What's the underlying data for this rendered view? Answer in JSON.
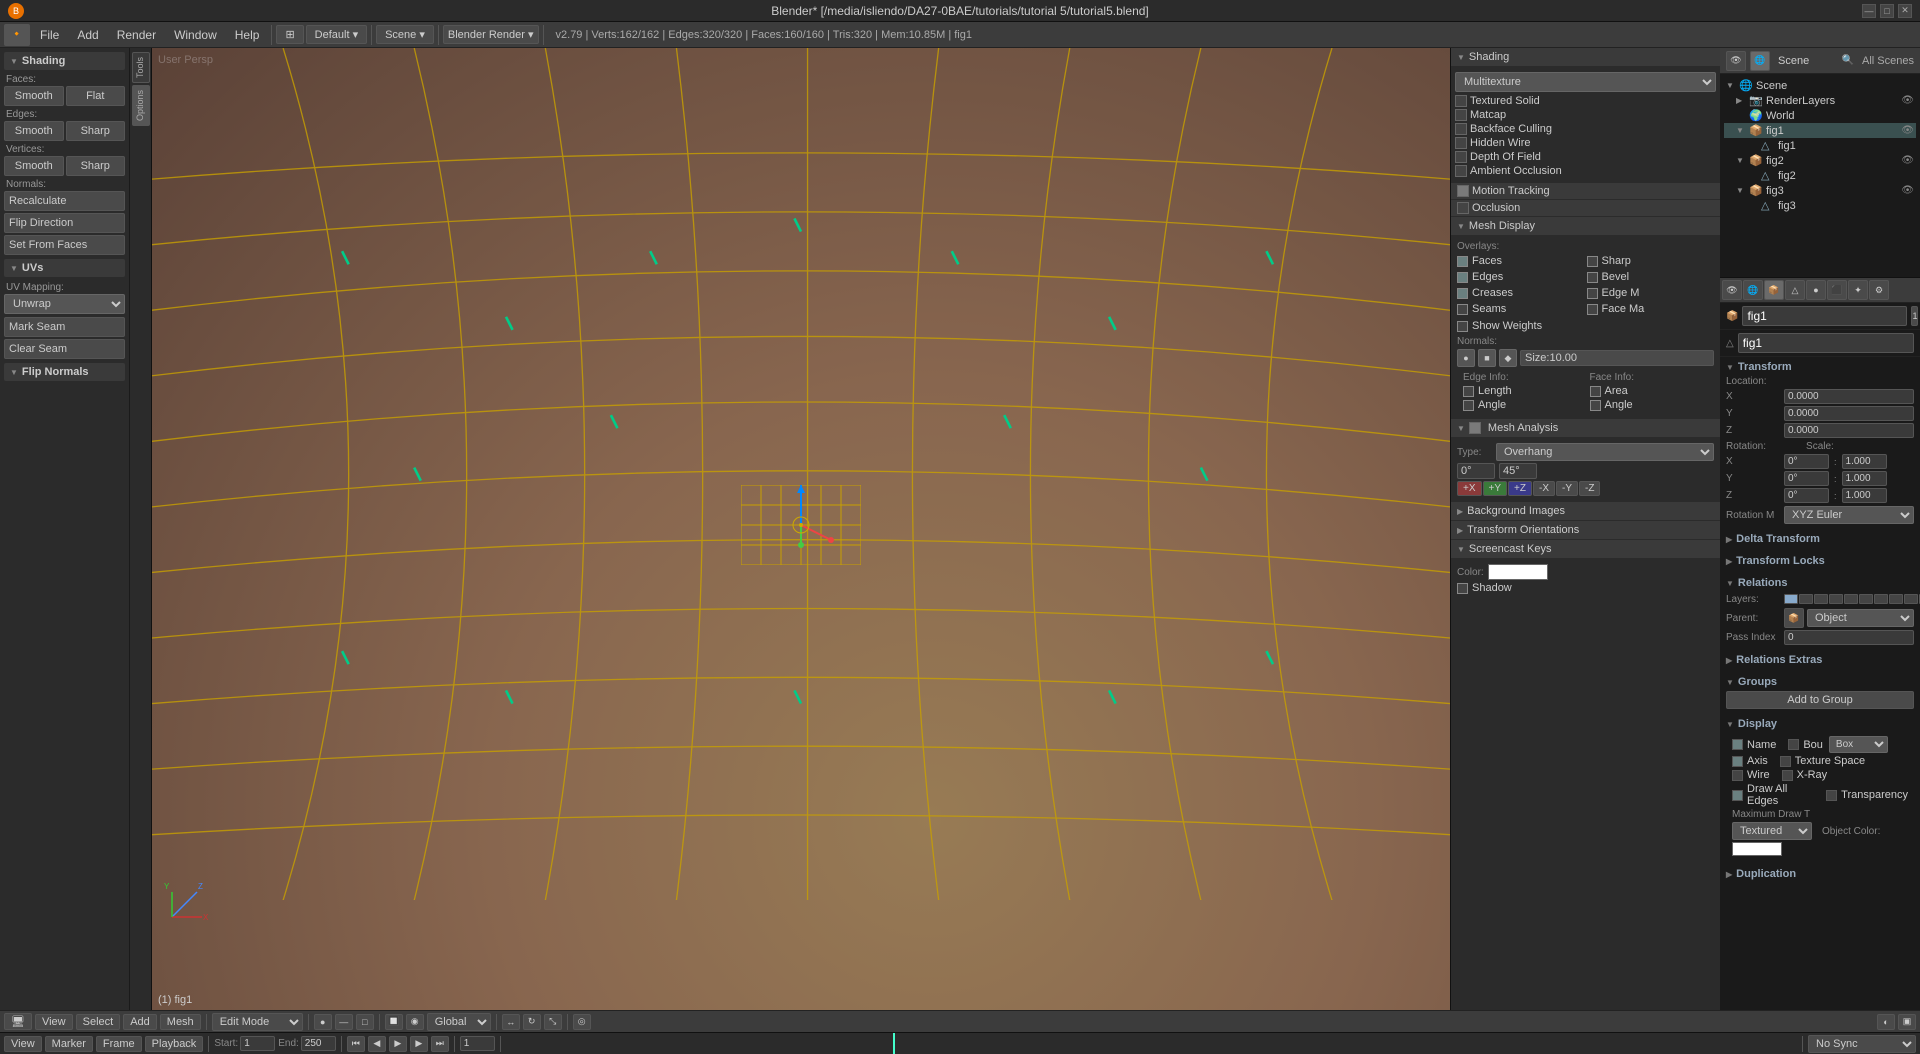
{
  "titlebar": {
    "title": "Blender* [/media/isliendo/DA27-0BAE/tutorials/tutorial 5/tutorial5.blend]",
    "minimize": "—",
    "maximize": "□",
    "close": "✕"
  },
  "menubar": {
    "engine": "Blender Render",
    "scene": "Scene",
    "layout": "Default",
    "version_info": "v2.79 | Verts:162/162 | Edges:320/320 | Faces:160/160 | Tris:320 | Mem:10.85M | fig1",
    "menus": [
      "File",
      "Add",
      "Render",
      "Window",
      "Help"
    ]
  },
  "viewport": {
    "label": "User Persp",
    "status": "(1) fig1"
  },
  "left_panel": {
    "sections": [
      {
        "id": "shading",
        "title": "Shading",
        "items": [
          {
            "type": "label",
            "text": "Faces:"
          },
          {
            "type": "buttons",
            "labels": [
              "Smooth",
              "Flat"
            ]
          },
          {
            "type": "label",
            "text": "Edges:"
          },
          {
            "type": "buttons",
            "labels": [
              "Smooth",
              "Sharp"
            ]
          },
          {
            "type": "label",
            "text": "Vertices:"
          },
          {
            "type": "buttons",
            "labels": [
              "Smooth",
              "Sharp"
            ]
          },
          {
            "type": "label",
            "text": "Normals:"
          },
          {
            "type": "button_full",
            "text": "Recalculate"
          },
          {
            "type": "button_full",
            "text": "Flip Direction"
          },
          {
            "type": "button_full",
            "text": "Set From Faces"
          }
        ]
      },
      {
        "id": "uvs",
        "title": "UVs",
        "items": []
      },
      {
        "id": "uv_mapping",
        "title": "UV Mapping:",
        "items": [
          {
            "type": "dropdown",
            "value": "Unwrap"
          },
          {
            "type": "button_full",
            "text": "Mark Seam"
          },
          {
            "type": "button_full",
            "text": "Clear Seam"
          }
        ]
      },
      {
        "id": "flip_normals",
        "title": "Flip Normals",
        "collapsed": true
      }
    ]
  },
  "n_panel": {
    "shading_section": {
      "title": "Shading",
      "dropdown": "Multitexture",
      "options": [
        {
          "label": "Textured Solid",
          "checked": false
        },
        {
          "label": "Matcap",
          "checked": false
        },
        {
          "label": "Backface Culling",
          "checked": false
        },
        {
          "label": "Hidden Wire",
          "checked": false
        },
        {
          "label": "Depth Of Field",
          "checked": false
        },
        {
          "label": "Ambient Occlusion",
          "checked": false
        }
      ]
    },
    "motion_tracking": {
      "title": "Motion Tracking",
      "checked": true
    },
    "mesh_display": {
      "title": "Mesh Display",
      "overlays_label": "Overlays:",
      "overlays": [
        {
          "label": "Faces",
          "checked": true,
          "label2": "Sharp",
          "checked2": false
        },
        {
          "label": "Edges",
          "checked": true,
          "label2": "Bevel",
          "checked2": false
        },
        {
          "label": "Creases",
          "checked": true,
          "label2": "Edge M",
          "checked2": false
        },
        {
          "label": "Seams",
          "checked": false,
          "label2": "Face Ma",
          "checked2": false
        }
      ],
      "show_weights": {
        "label": "Show Weights",
        "checked": false
      },
      "normals_label": "Normals:",
      "normals_btns": [
        "●",
        "■",
        "◆"
      ],
      "normals_size": "Size:10.00",
      "edge_info": {
        "label1": "Edge Info:",
        "col1": [
          {
            "label": "Length",
            "checked": false
          },
          {
            "label": "Angle",
            "checked": false
          }
        ],
        "label2": "Face Info:",
        "col2": [
          {
            "label": "Area",
            "checked": false
          },
          {
            "label": "Angle",
            "checked": false
          }
        ]
      }
    },
    "mesh_analysis": {
      "title": "Mesh Analysis",
      "type_label": "Type:",
      "type_value": "Overhang",
      "range": [
        "0°",
        "45°"
      ],
      "xyz_btns": [
        "+X",
        "+Y",
        "+Z",
        "-X",
        "-Y",
        "-Z"
      ]
    },
    "background_images": {
      "title": "Background Images",
      "collapsed": true
    },
    "transform_orientations": {
      "title": "Transform Orientations",
      "collapsed": true
    },
    "screencast_keys": {
      "title": "Screencast Keys",
      "color_label": "Color:",
      "shadow_label": "Shadow",
      "shadow_checked": false
    }
  },
  "properties_panel": {
    "object_name": "fig1",
    "mesh_name": "fig1",
    "tabs": [
      "scene",
      "render",
      "layers",
      "world",
      "object",
      "constraints",
      "modifier",
      "particles",
      "physics",
      "data",
      "material",
      "texture"
    ],
    "transform": {
      "title": "Transform",
      "location": {
        "x": "0.0000",
        "y": "0.0000",
        "z": "0.0000"
      },
      "rotation": {
        "x": "0°",
        "y": "0°",
        "z": "0°"
      },
      "scale": {
        "x": "1.000",
        "y": "1.000",
        "z": "1.000"
      },
      "rotation_mode": "XYZ Euler"
    },
    "delta_transform": {
      "title": "Delta Transform"
    },
    "transform_locks": {
      "title": "Transform Locks"
    },
    "relations": {
      "title": "Relations",
      "layers_label": "Layers:",
      "parent_label": "Parent:",
      "pass_index": "0"
    },
    "relations_extras": {
      "title": "Relations Extras"
    },
    "groups": {
      "title": "Groups",
      "add_btn": "Add to Group"
    },
    "display": {
      "title": "Display",
      "name_label": "Name",
      "name_val": "",
      "axis_label": "Axis",
      "wire_label": "Wire",
      "draw_all_edges": "Draw All Edges",
      "max_draw_t": "Maximum Draw T",
      "textured": "Textured",
      "bou_label": "Bou",
      "bou_val": "Box",
      "texture_space": "Texture Space",
      "x_ray": "X-Ray",
      "transparency": "Transparency",
      "object_color_label": "Object Color:"
    },
    "duplication": {
      "title": "Duplication"
    }
  },
  "outliner": {
    "scene_label": "Scene",
    "all_scenes": "All Scenes",
    "items": [
      {
        "name": "Scene",
        "type": "scene",
        "expanded": true,
        "indent": 0
      },
      {
        "name": "RenderLayers",
        "type": "render",
        "expanded": false,
        "indent": 1
      },
      {
        "name": "World",
        "type": "world",
        "expanded": false,
        "indent": 1
      },
      {
        "name": "fig1",
        "type": "object",
        "expanded": true,
        "indent": 1
      },
      {
        "name": "fig1",
        "type": "mesh",
        "expanded": false,
        "indent": 2
      },
      {
        "name": "fig2",
        "type": "object",
        "expanded": true,
        "indent": 1
      },
      {
        "name": "fig2",
        "type": "mesh",
        "expanded": false,
        "indent": 2
      },
      {
        "name": "fig3",
        "type": "object",
        "expanded": true,
        "indent": 1
      },
      {
        "name": "fig3",
        "type": "mesh",
        "expanded": false,
        "indent": 2
      }
    ]
  },
  "bottom_toolbar": {
    "view_btn": "View",
    "select_btn": "Select",
    "add_btn": "Add",
    "mesh_btn": "Mesh",
    "mode": "Edit Mode",
    "global_btn": "Global"
  },
  "timeline": {
    "start": "1",
    "end": "250",
    "current": "1",
    "no_sync": "No Sync"
  }
}
